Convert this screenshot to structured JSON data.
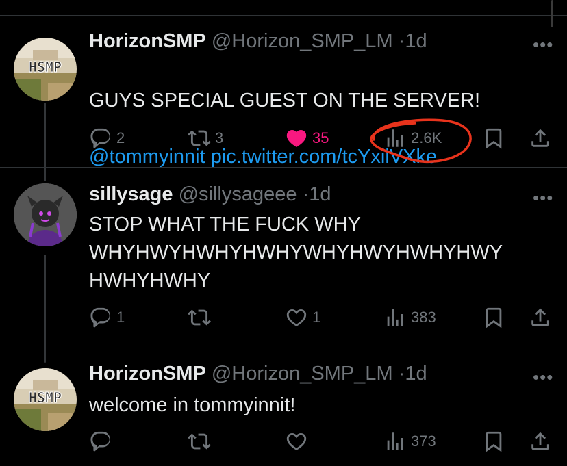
{
  "tweets": [
    {
      "name": "HorizonSMP",
      "handle": "@Horizon_SMP_LM",
      "sep": "·",
      "time": "1d",
      "avatar_text": "HSMP",
      "text": "GUYS SPECIAL GUEST ON THE SERVER!",
      "mention": "@tommyinnit",
      "link": "pic.twitter.com/tcYxiiVXke",
      "replies": "2",
      "retweets": "3",
      "likes": "35",
      "views": "2.6K",
      "liked": true
    },
    {
      "name": "sillysage",
      "handle": "@sillysageee",
      "sep": "·",
      "time": "1d",
      "text": "STOP WHAT THE FUCK WHY\nWHYHWYHWHYHWHYWHYHWYHWHYHWY\nHWHYHWHY",
      "replies": "1",
      "retweets": "",
      "likes": "1",
      "views": "383",
      "liked": false
    },
    {
      "name": "HorizonSMP",
      "handle": "@Horizon_SMP_LM",
      "sep": "·",
      "time": "1d",
      "avatar_text": "HSMP",
      "text": "welcome in tommyinnit!",
      "replies": "",
      "retweets": "",
      "likes": "",
      "views": "373",
      "liked": false
    }
  ],
  "more_label": "•••",
  "colors": {
    "background": "#000000",
    "text": "#e7e9ea",
    "muted": "#71767b",
    "link": "#1d9bf0",
    "like": "#f91880",
    "annotation": "#e8331c"
  },
  "icons": [
    "reply-icon",
    "retweet-icon",
    "like-icon",
    "views-icon",
    "bookmark-icon",
    "share-icon",
    "more-icon"
  ]
}
